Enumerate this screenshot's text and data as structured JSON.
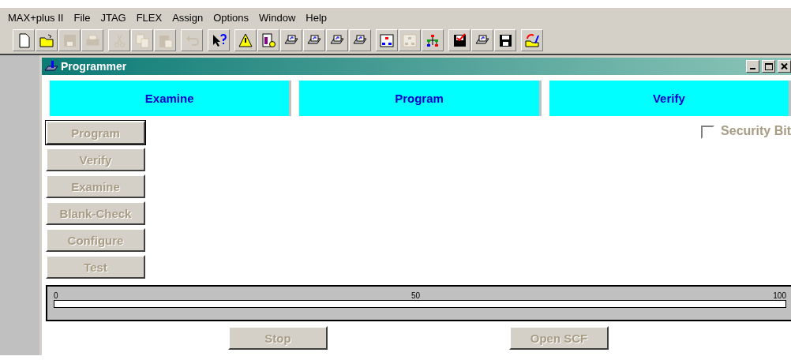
{
  "menu_bar": [
    "MAX+plus II",
    "File",
    "JTAG",
    "FLEX",
    "Assign",
    "Options",
    "Window",
    "Help"
  ],
  "toolbar": [
    [
      {
        "kind": "page",
        "disabled": false
      },
      {
        "kind": "folder",
        "disabled": false
      },
      {
        "kind": "floppy",
        "disabled": true
      },
      {
        "kind": "printer",
        "disabled": true
      }
    ],
    [
      {
        "kind": "scissors",
        "disabled": true
      },
      {
        "kind": "copy",
        "disabled": true
      },
      {
        "kind": "paste",
        "disabled": true
      }
    ],
    [
      {
        "kind": "undo",
        "disabled": true
      }
    ],
    [
      {
        "kind": "help",
        "disabled": false
      }
    ],
    [
      {
        "kind": "warning",
        "disabled": false
      },
      {
        "kind": "doc",
        "disabled": false
      },
      {
        "kind": "device",
        "disabled": false
      },
      {
        "kind": "device",
        "disabled": false
      },
      {
        "kind": "device",
        "disabled": false
      },
      {
        "kind": "device",
        "disabled": false
      }
    ],
    [
      {
        "kind": "hierarchy-doc",
        "disabled": false
      },
      {
        "kind": "hierarchy-doc",
        "disabled": true
      },
      {
        "kind": "hierarchy",
        "disabled": false
      }
    ],
    [
      {
        "kind": "floppy-check",
        "disabled": false
      },
      {
        "kind": "device",
        "disabled": false
      },
      {
        "kind": "floppy",
        "disabled": false
      }
    ],
    [
      {
        "kind": "folder-arrow",
        "disabled": false
      }
    ]
  ],
  "window": {
    "title": "Programmer",
    "headers": [
      "Examine",
      "Program",
      "Verify"
    ],
    "actions": [
      {
        "label": "Program",
        "disabled": true,
        "default": true
      },
      {
        "label": "Verify",
        "disabled": true,
        "default": false
      },
      {
        "label": "Examine",
        "disabled": true,
        "default": false
      },
      {
        "label": "Blank-Check",
        "disabled": true,
        "default": false
      },
      {
        "label": "Configure",
        "disabled": true,
        "default": false
      },
      {
        "label": "Test",
        "disabled": true,
        "default": false
      }
    ],
    "security_bit": {
      "label": "Security Bit",
      "checked": false,
      "disabled": true
    },
    "progress": {
      "level": 0,
      "ticks": [
        "0",
        "50",
        "100"
      ]
    },
    "buttons": [
      {
        "label": "Stop",
        "disabled": true
      },
      {
        "label": "Open SCF",
        "disabled": true
      }
    ]
  }
}
